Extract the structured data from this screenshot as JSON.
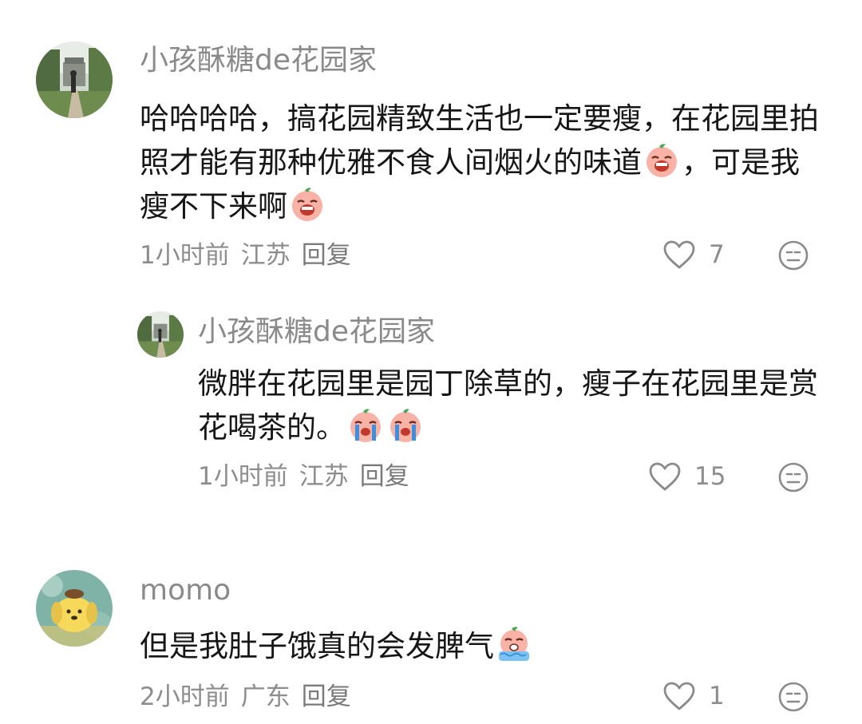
{
  "comments": [
    {
      "username": "小孩酥糖de花园家",
      "text_part1": "哈哈哈哈，搞花园精致生活也一定要瘦，在花园里拍照才能有那种优雅不食人间烟火的味道",
      "text_part2": "，可是我瘦不下来啊",
      "emoji_name": "crying-face-emoji",
      "time": "1小时前",
      "location": "江苏",
      "reply_label": "回复",
      "likes": "7",
      "replies": [
        {
          "username": "小孩酥糖de花园家",
          "text": "微胖在花园里是园丁除草的，瘦子在花园里是赏花喝茶的。",
          "emoji_name": "tears-emoji",
          "time": "1小时前",
          "location": "江苏",
          "reply_label": "回复",
          "likes": "15"
        }
      ]
    },
    {
      "username": "momo",
      "text": "但是我肚子饿真的会发脾气",
      "emoji_name": "sobbing-emoji",
      "time": "2小时前",
      "location": "广东",
      "reply_label": "回复",
      "likes": "1"
    }
  ],
  "icons": {
    "like": "heart-outline-icon",
    "dislike": "meh-face-icon"
  },
  "colors": {
    "username": "#8a8a8a",
    "meta": "#8d8d8d",
    "text": "#161616",
    "emoji": "#f48a7c"
  }
}
